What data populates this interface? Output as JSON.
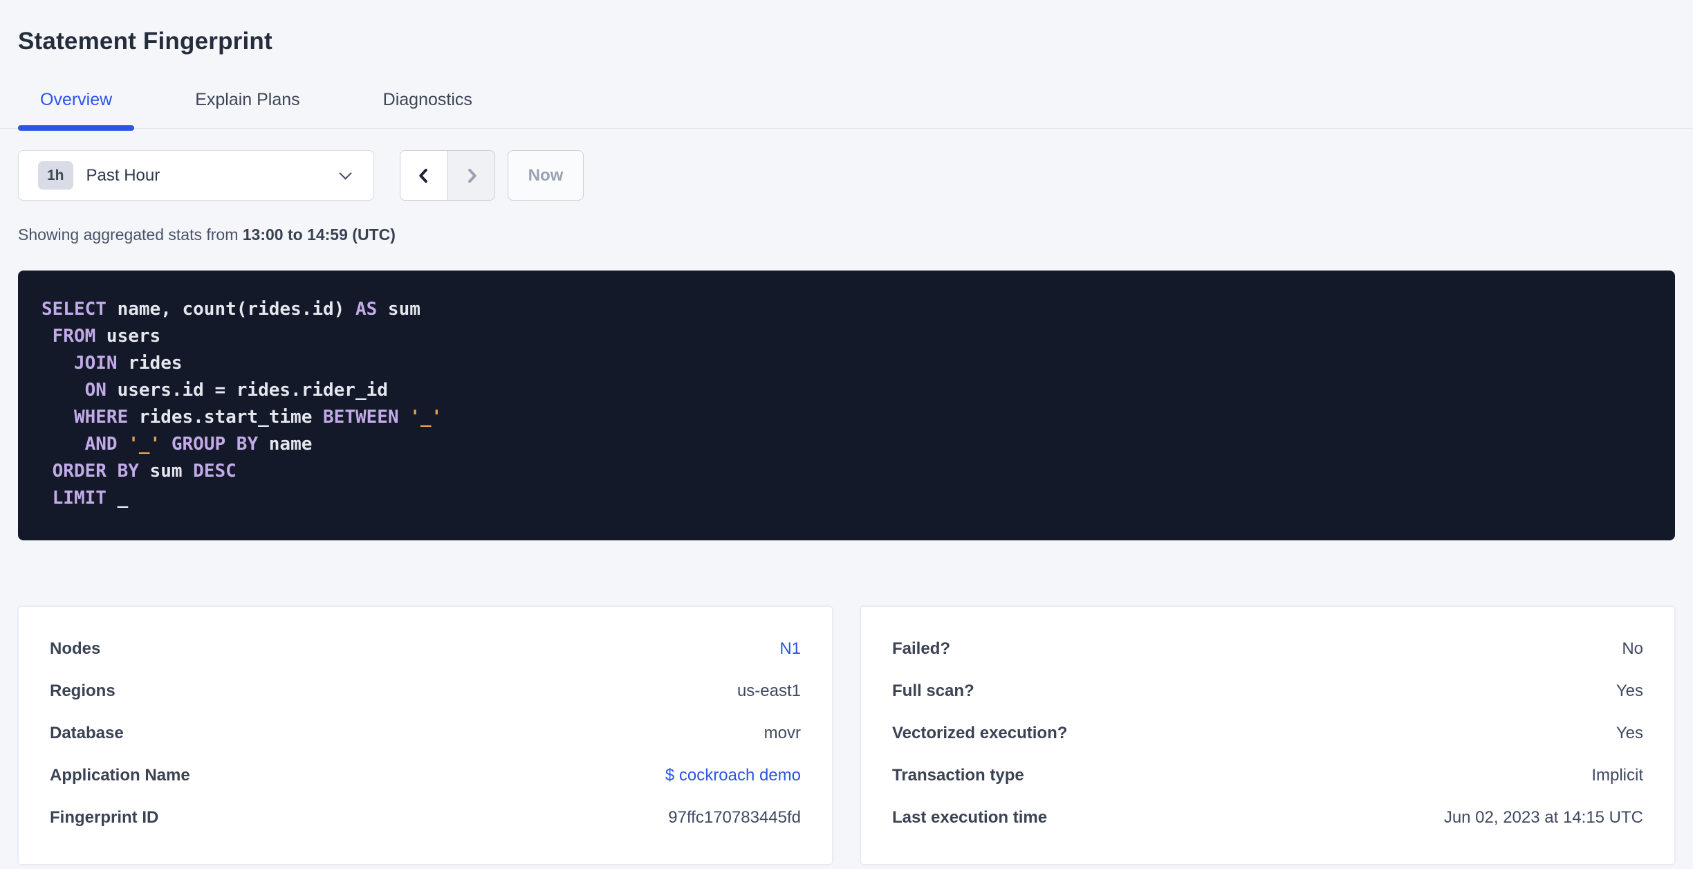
{
  "title": "Statement Fingerprint",
  "tabs": [
    {
      "label": "Overview",
      "active": true
    },
    {
      "label": "Explain Plans",
      "active": false
    },
    {
      "label": "Diagnostics",
      "active": false
    }
  ],
  "time_controls": {
    "interval_badge": "1h",
    "interval_label": "Past Hour",
    "now_label": "Now",
    "prev_enabled": true,
    "next_enabled": false
  },
  "summary": {
    "prefix": "Showing aggregated stats from ",
    "bold_range": "13:00 to 14:59 (UTC)"
  },
  "sql": {
    "lines": [
      [
        {
          "c": "kw",
          "t": "SELECT"
        },
        {
          "c": "pl",
          "t": " name, count(rides.id) "
        },
        {
          "c": "kw",
          "t": "AS"
        },
        {
          "c": "pl",
          "t": " sum"
        }
      ],
      [
        {
          "c": "pl",
          "t": " "
        },
        {
          "c": "kw",
          "t": "FROM"
        },
        {
          "c": "pl",
          "t": " users"
        }
      ],
      [
        {
          "c": "pl",
          "t": "   "
        },
        {
          "c": "kw",
          "t": "JOIN"
        },
        {
          "c": "pl",
          "t": " rides"
        }
      ],
      [
        {
          "c": "pl",
          "t": "    "
        },
        {
          "c": "kw",
          "t": "ON"
        },
        {
          "c": "pl",
          "t": " users.id = rides.rider_id"
        }
      ],
      [
        {
          "c": "pl",
          "t": "   "
        },
        {
          "c": "kw",
          "t": "WHERE"
        },
        {
          "c": "pl",
          "t": " rides.start_time "
        },
        {
          "c": "kw",
          "t": "BETWEEN"
        },
        {
          "c": "pl",
          "t": " "
        },
        {
          "c": "str",
          "t": "'_'"
        }
      ],
      [
        {
          "c": "pl",
          "t": "    "
        },
        {
          "c": "kw",
          "t": "AND"
        },
        {
          "c": "pl",
          "t": " "
        },
        {
          "c": "str",
          "t": "'_'"
        },
        {
          "c": "pl",
          "t": " "
        },
        {
          "c": "kw",
          "t": "GROUP BY"
        },
        {
          "c": "pl",
          "t": " name"
        }
      ],
      [
        {
          "c": "pl",
          "t": " "
        },
        {
          "c": "kw",
          "t": "ORDER BY"
        },
        {
          "c": "pl",
          "t": " sum "
        },
        {
          "c": "kw",
          "t": "DESC"
        }
      ],
      [
        {
          "c": "pl",
          "t": " "
        },
        {
          "c": "kw",
          "t": "LIMIT"
        },
        {
          "c": "pl",
          "t": " _"
        }
      ]
    ]
  },
  "details_cards": {
    "left": [
      {
        "label": "Nodes",
        "value": "N1",
        "link": true
      },
      {
        "label": "Regions",
        "value": "us-east1",
        "link": false
      },
      {
        "label": "Database",
        "value": "movr",
        "link": false
      },
      {
        "label": "Application Name",
        "value": "$ cockroach demo",
        "link": true
      },
      {
        "label": "Fingerprint ID",
        "value": "97ffc170783445fd",
        "link": false
      }
    ],
    "right": [
      {
        "label": "Failed?",
        "value": "No",
        "link": false
      },
      {
        "label": "Full scan?",
        "value": "Yes",
        "link": false
      },
      {
        "label": "Vectorized execution?",
        "value": "Yes",
        "link": false
      },
      {
        "label": "Transaction type",
        "value": "Implicit",
        "link": false
      },
      {
        "label": "Last execution time",
        "value": "Jun 02, 2023 at 14:15 UTC",
        "link": false
      }
    ]
  },
  "colors": {
    "accent_blue": "#2c55e6",
    "page_background": "#f4f6fa",
    "code_background": "#131929",
    "code_keyword": "#c2abe8",
    "code_plain": "#e5e7ee",
    "code_string": "#e6a24b",
    "disabled_text": "#9aa2b4"
  }
}
